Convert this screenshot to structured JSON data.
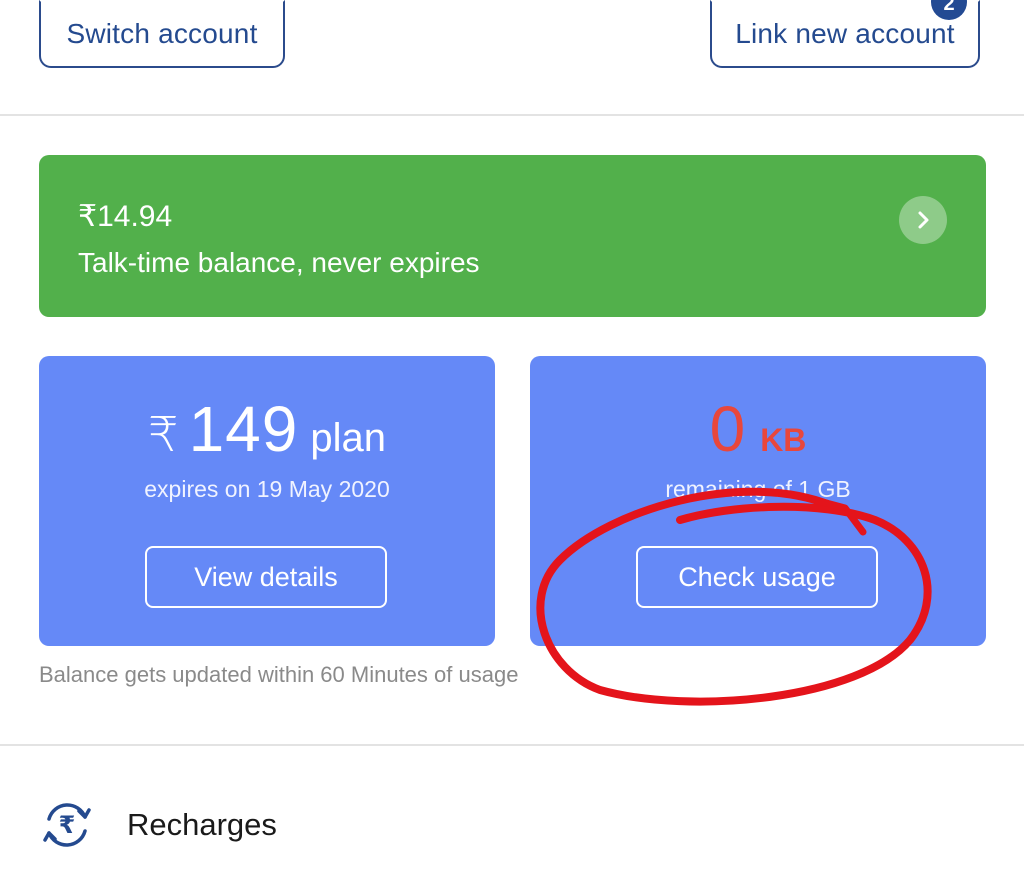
{
  "header": {
    "switch_account_label": "Switch account",
    "link_new_account_label": "Link new account",
    "notification_count": "2"
  },
  "talktime": {
    "amount": "₹14.94",
    "label": "Talk-time balance, never expires"
  },
  "plan": {
    "currency": "₹",
    "price": "149",
    "unit": "plan",
    "expiry": "expires on 19 May 2020",
    "button_label": "View details"
  },
  "data_usage": {
    "value": "0",
    "unit": "KB",
    "remaining": "remaining of 1 GB",
    "button_label": "Check usage"
  },
  "note": "Balance gets updated within 60 Minutes of usage",
  "recharges": {
    "label": "Recharges",
    "icon": "rupee-refresh-icon"
  },
  "colors": {
    "talktime_card": "#52b04b",
    "plan_card": "#6589f7",
    "accent_blue": "#244a8f",
    "data_value": "#e8473c",
    "annotation_red": "#e4141b"
  }
}
